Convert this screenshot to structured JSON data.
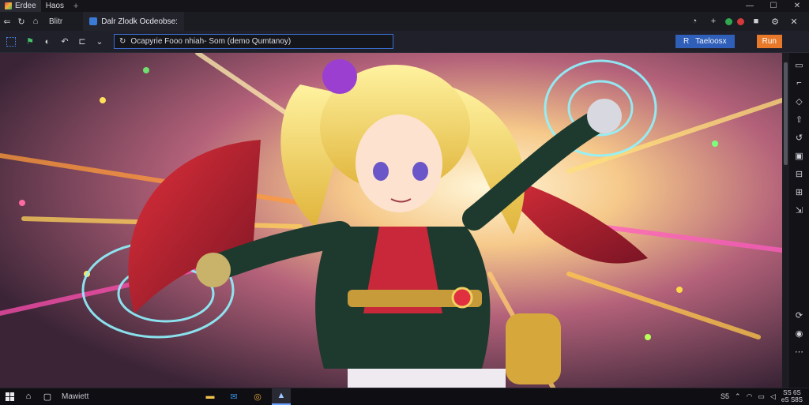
{
  "window": {
    "tabs": [
      {
        "label": "Erdee",
        "active": true
      },
      {
        "label": "Haos",
        "active": false
      }
    ],
    "add_tab": "+",
    "controls": {
      "minimize": "—",
      "maximize": "☐",
      "close": "✕"
    }
  },
  "nav": {
    "app_title": "Blitr",
    "doc_tab_label": "Dalr Zlodk Ocdeobse:",
    "right_icons": [
      "help-icon",
      "plus-icon",
      "shield-icon",
      "record-icon",
      "stop-icon",
      "settings-icon",
      "close-icon"
    ]
  },
  "toolbar": {
    "address_value": "Ocapyrie Fooo nhiah- Som (demo Qumtanoy)",
    "primary_button": {
      "icon": "R",
      "label": "Taeloosx"
    },
    "run_button": "Run"
  },
  "colors": {
    "accent": "#2f5fb8",
    "run": "#e8792a",
    "chrome": "#1b1b22"
  },
  "taskbar": {
    "search_label": "Mawiett",
    "tray_left": "S5",
    "tray_items": [
      "chevron-icon",
      "wifi-icon",
      "battery-icon",
      "volume-icon"
    ],
    "clock_line1": "SS 6S",
    "clock_line2": "eS S8S"
  }
}
